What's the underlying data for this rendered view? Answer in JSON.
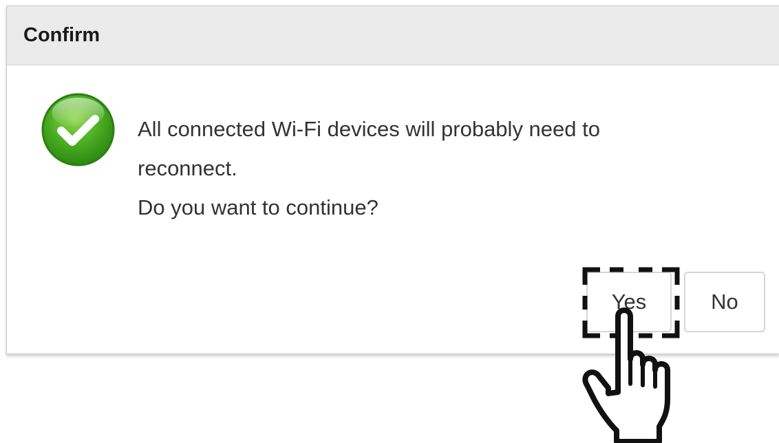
{
  "dialog": {
    "title": "Confirm",
    "icon": "success-check-icon",
    "message_lines": [
      "All connected Wi-Fi devices will probably need to",
      "reconnect.",
      "Do you want to continue?"
    ],
    "buttons": {
      "yes_label": "Yes",
      "no_label": "No"
    }
  },
  "overlay": {
    "focus_indicator": "dashed-corner-bracket",
    "pointer": "hand-pointer-icon"
  },
  "colors": {
    "header_bg": "#ebebeb",
    "icon_green": "#3fa51e",
    "text": "#333333"
  }
}
